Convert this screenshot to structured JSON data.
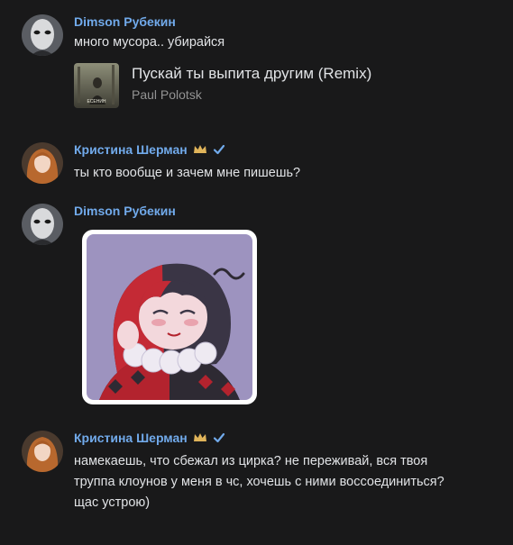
{
  "colors": {
    "background": "#19191a",
    "name": "#71aaeb",
    "text": "#e1e3e6",
    "muted": "#939393"
  },
  "messages": [
    {
      "author": "Dimson Рубекин",
      "text": "много мусора.. убирайся",
      "attachment": {
        "type": "audio",
        "title": "Пускай ты выпита другим (Remix)",
        "artist": "Paul Polotsk",
        "cover_caption": "ЕСЕНИН"
      }
    },
    {
      "author": "Кристина Шерман",
      "badges": [
        "crown-icon",
        "verified-check-icon"
      ],
      "text": "ты кто вообще и зачем мне пишешь?"
    },
    {
      "author": "Dimson Рубекин",
      "attachment": {
        "type": "sticker",
        "description": "harlequin-girl-sticker"
      }
    },
    {
      "author": "Кристина Шерман",
      "badges": [
        "crown-icon",
        "verified-check-icon"
      ],
      "lines": [
        "намекаешь, что сбежал из цирка? не переживай, вся твоя",
        "труппа клоунов у меня в чс, хочешь с ними воссоединиться?",
        "щас устрою)"
      ]
    }
  ]
}
